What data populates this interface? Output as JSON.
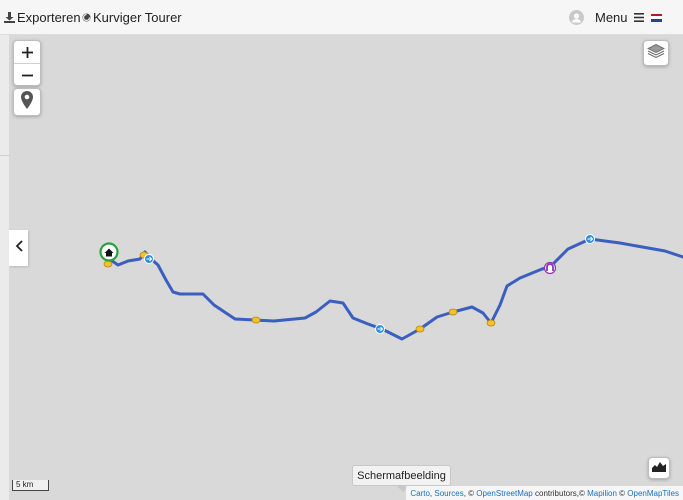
{
  "topbar": {
    "export_label": "Exporteren",
    "app_label": "Kurviger Tourer",
    "menu_label": "Menu",
    "language_flag": "nl-flag"
  },
  "map": {
    "scale_label": "5 km",
    "tooltip": "Schermafbeelding",
    "attribution": {
      "carto": "Carto",
      "sep1": ", ",
      "sources": "Sources",
      "sep2": ", © ",
      "osm": "OpenStreetMap",
      "contributors": " contributors,© ",
      "mapilion": "Mapilion",
      "sep3": " © ",
      "openmaptiles": "OpenMapTiles"
    },
    "route_color": "#3a5fc0",
    "start_marker_color": "#27a23a",
    "waypoint_color": "#f2c12e",
    "direction_marker_color": "#2b8ee0",
    "tunnel_marker_color": "#8a35b8"
  },
  "icons": {
    "export": "download-icon",
    "app": "kurviger-logo-icon",
    "user": "user-avatar-icon",
    "menu": "hamburger-menu-icon",
    "zoom_in": "plus-icon",
    "zoom_out": "minus-icon",
    "locate": "map-pin-icon",
    "layers": "layers-icon",
    "collapse": "chevron-left-icon",
    "elevation": "elevation-profile-icon"
  }
}
